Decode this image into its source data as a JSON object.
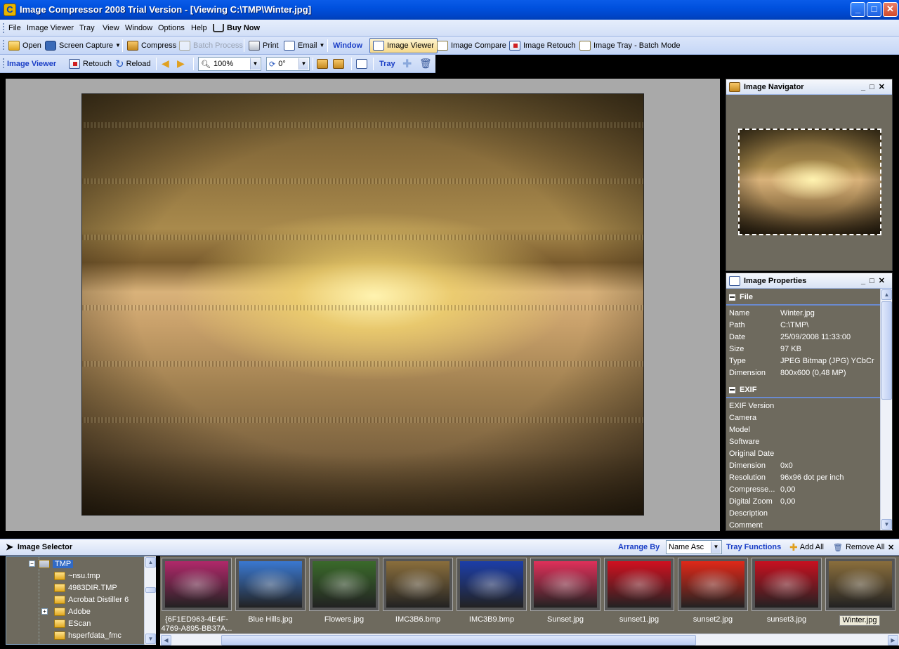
{
  "window": {
    "title": "Image Compressor 2008 Trial Version - [Viewing C:\\TMP\\Winter.jpg]",
    "app_icon": "C",
    "controls": {
      "minimize": "_",
      "maximize": "□",
      "close": "✕"
    }
  },
  "menu": [
    "File",
    "Image Viewer",
    "Tray",
    "View",
    "Window",
    "Options",
    "Help",
    "Buy Now"
  ],
  "toolbar1": {
    "open": "Open",
    "screen_capture": "Screen Capture",
    "compress": "Compress",
    "batch_process": "Batch Process",
    "print": "Print",
    "email": "Email",
    "window_label": "Window",
    "image_viewer": "Image Viewer",
    "image_compare": "Image Compare",
    "image_retouch": "Image Retouch",
    "image_tray": "Image Tray - Batch Mode"
  },
  "toolbar2": {
    "label": "Image Viewer",
    "retouch": "Retouch",
    "reload": "Reload",
    "zoom": "100%",
    "rotation": "0°",
    "tray_label": "Tray"
  },
  "navigator": {
    "title": "Image Navigator"
  },
  "properties": {
    "title": "Image Properties",
    "file_section": "File",
    "file_rows": [
      {
        "key": "Name",
        "value": "Winter.jpg"
      },
      {
        "key": "Path",
        "value": "C:\\TMP\\"
      },
      {
        "key": "Date",
        "value": "25/09/2008 11:33:00"
      },
      {
        "key": "Size",
        "value": "97 KB"
      },
      {
        "key": "Type",
        "value": "JPEG Bitmap (JPG) YCbCr"
      },
      {
        "key": "Dimension",
        "value": "800x600 (0,48 MP)"
      }
    ],
    "exif_section": "EXIF",
    "exif_rows": [
      {
        "key": "EXIF Version",
        "value": ""
      },
      {
        "key": "Camera",
        "value": ""
      },
      {
        "key": "Model",
        "value": ""
      },
      {
        "key": "Software",
        "value": ""
      },
      {
        "key": "Original Date",
        "value": ""
      },
      {
        "key": "Dimension",
        "value": "0x0"
      },
      {
        "key": "Resolution",
        "value": "96x96 dot per inch"
      },
      {
        "key": "Compresse...",
        "value": "0,00"
      },
      {
        "key": "Digital Zoom",
        "value": "0,00"
      },
      {
        "key": "Description",
        "value": ""
      },
      {
        "key": "Comment",
        "value": ""
      }
    ]
  },
  "selector": {
    "title": "Image Selector",
    "arrange_by_label": "Arrange By",
    "arrange_by_value": "Name Asc",
    "tray_functions": "Tray Functions",
    "add_all": "Add All",
    "remove_all": "Remove All",
    "close": "✕"
  },
  "tree": [
    {
      "label": "TMP",
      "selected": true
    },
    {
      "label": "~nsu.tmp"
    },
    {
      "label": "4983DIR.TMP"
    },
    {
      "label": "Acrobat Distiller 6"
    },
    {
      "label": "Adobe"
    },
    {
      "label": "EScan"
    },
    {
      "label": "hsperfdata_fmc"
    }
  ],
  "thumbnails": [
    {
      "label": "{6F1ED963-4E4F-4769-A895-BB37A...",
      "color": "#b0286a"
    },
    {
      "label": "Blue Hills.jpg",
      "color": "#3a78d0"
    },
    {
      "label": "Flowers.jpg",
      "color": "#3a6a2a"
    },
    {
      "label": "IMC3B6.bmp",
      "color": "#8a6e3c"
    },
    {
      "label": "IMC3B9.bmp",
      "color": "#1c3ea8"
    },
    {
      "label": "Sunset.jpg",
      "color": "#e0305a"
    },
    {
      "label": "sunset1.jpg",
      "color": "#d01020"
    },
    {
      "label": "sunset2.jpg",
      "color": "#e02818"
    },
    {
      "label": "sunset3.jpg",
      "color": "#c81020"
    },
    {
      "label": "Winter.jpg",
      "color": "#8a6e3c",
      "selected": true
    }
  ],
  "colors": {
    "titlebar": "#0050de",
    "panel_bg": "#6e6a5e",
    "viewer_bg": "#a9a9a9",
    "accent_blue": "#1a3ec6"
  }
}
